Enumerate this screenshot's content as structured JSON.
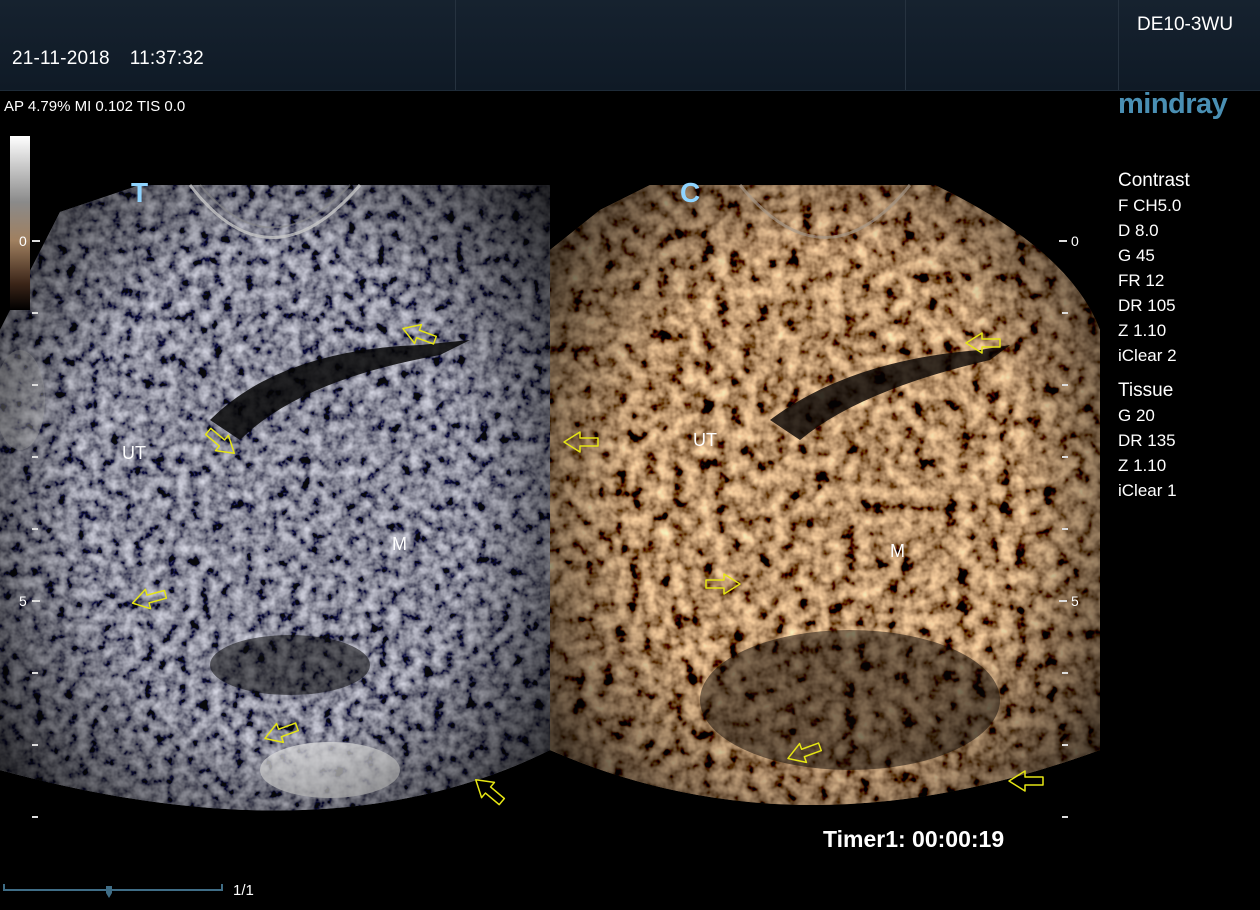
{
  "header": {
    "date": "21-11-2018",
    "time": "11:37:32",
    "probe": "DE10-3WU"
  },
  "acoustic": "AP 4.79%  MI 0.102 TIS 0.0",
  "brand": "mindray",
  "panels": {
    "left": {
      "mode": "T",
      "labels": {
        "ut": "UT",
        "m": "M"
      }
    },
    "right": {
      "mode": "C",
      "labels": {
        "ut": "UT",
        "m": "M"
      }
    }
  },
  "depth_scale": {
    "top": "0",
    "mid": "5"
  },
  "contrast": {
    "heading": "Contrast",
    "items": [
      "F CH5.0",
      "D 8.0",
      "G 45",
      "FR 12",
      "DR 105",
      "Z 1.10",
      "iClear 2"
    ]
  },
  "tissue": {
    "heading": "Tissue",
    "items": [
      "G 20",
      "DR 135",
      "Z 1.10",
      "iClear 1"
    ]
  },
  "timer": "Timer1: 00:00:19",
  "pager": "1/1",
  "cine_position": 0.48,
  "colors": {
    "arrow": "#e6e614",
    "mode_letter": "#8fd4ff",
    "logo": "#4a8fb3",
    "contrast_tint": "#c98b52"
  }
}
